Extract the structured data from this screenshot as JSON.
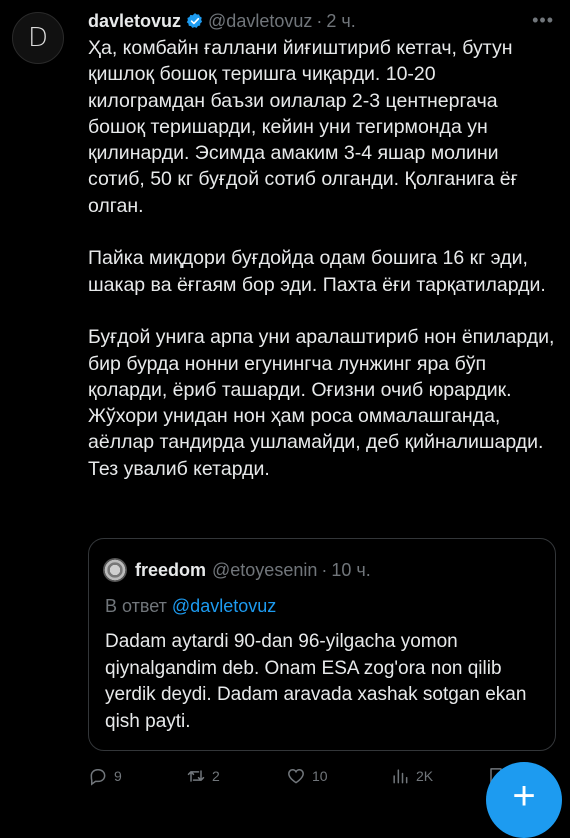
{
  "avatar": {
    "letter": "D"
  },
  "tweet": {
    "display_name": "davletovuz",
    "handle": "@davletovuz",
    "separator": "·",
    "time": "2 ч.",
    "more": "•••",
    "paragraphs": [
      "Ҳа, комбайн ғаллани йиғиштириб кетгач, бутун қишлоқ бошоқ теришга чиқарди. 10-20 килограмдан баъзи оилалар 2-3 центнергача бошоқ теришарди, кейин уни тегирмонда ун қилинарди. Эсимда амаким 3-4 яшар молини сотиб, 50 кг буғдой сотиб олганди. Қолганига ёғ олган.",
      "Пайка миқдори буғдойда одам бошига 16 кг эди, шакар ва ёғгаям бор эди. Пахта ёғи тарқатиларди.",
      "Буғдой унига арпа уни аралаштириб нон ёпиларди, бир бурда нонни егунингча лунжинг яра бўп қоларди, ёриб ташарди. Оғизни очиб юрардик. Жўхори унидан нон ҳам роса оммалашганда, аёллар тандирда ушламайди, деб қийналишарди. Тез увалиб кетарди."
    ]
  },
  "quote": {
    "display_name": "freedom",
    "handle": "@etoyesenin",
    "separator": "·",
    "time": "10 ч.",
    "reply_prefix": "В ответ",
    "reply_handle": "@davletovuz",
    "text": "Dadam aytardi 90-dan 96-yilgacha yomon qiynalgandim deb. Onam ESA zog'ora non qilib yerdik deydi. Dadam aravada xashak sotgan ekan qish payti."
  },
  "actions": {
    "replies": "9",
    "retweets": "2",
    "likes": "10",
    "views": "2K"
  },
  "fab": {
    "symbol": "+"
  },
  "colors": {
    "background": "#000000",
    "text": "#e7e9ea",
    "muted": "#71767b",
    "accent": "#1d9bf0",
    "border": "#333639"
  }
}
